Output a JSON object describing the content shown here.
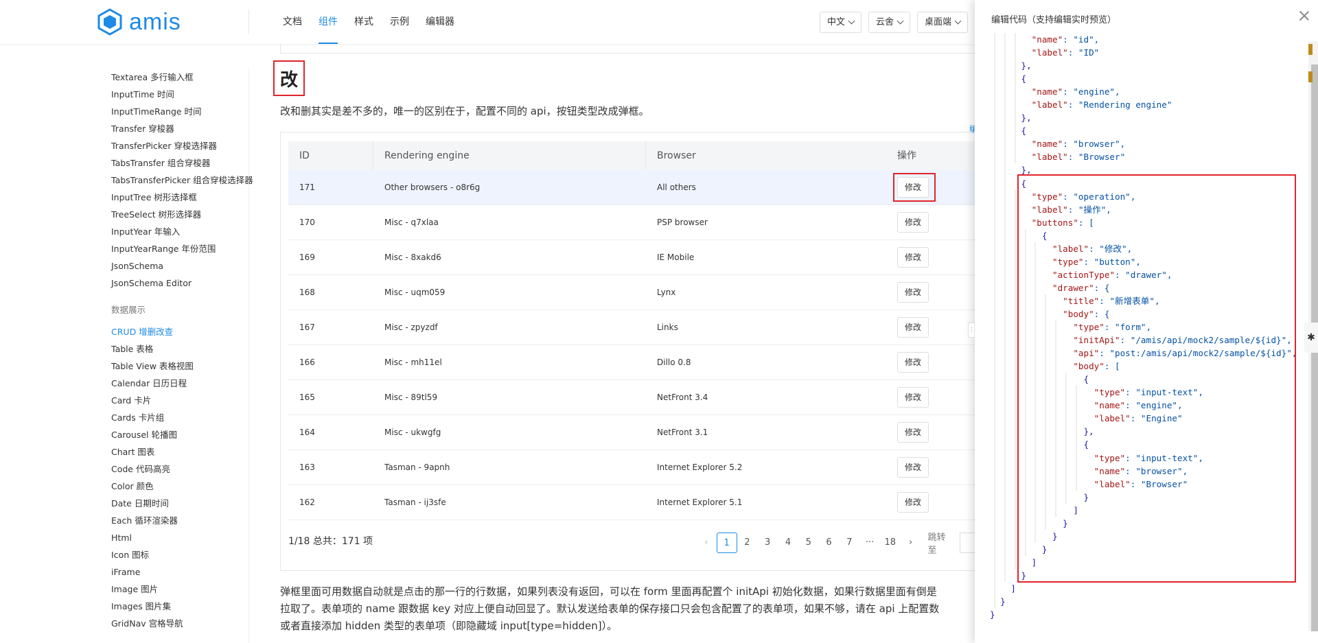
{
  "header": {
    "logo_text": "amis",
    "nav": [
      "文档",
      "组件",
      "样式",
      "示例",
      "编辑器"
    ],
    "nav_active": 1,
    "selects": [
      "中文",
      "云舍",
      "桌面端"
    ]
  },
  "sidebar": {
    "items_top": [
      "Textarea 多行输入框",
      "InputTime 时间",
      "InputTimeRange 时间",
      "Transfer 穿梭器",
      "TransferPicker 穿梭选择器",
      "TabsTransfer 组合穿梭器",
      "TabsTransferPicker 组合穿梭选择器",
      "InputTree 树形选择框",
      "TreeSelect 树形选择器",
      "InputYear 年输入",
      "InputYearRange 年份范围",
      "JsonSchema",
      "JsonSchema Editor"
    ],
    "group_label": "数据展示",
    "items_bottom": [
      "CRUD 增删改查",
      "Table 表格",
      "Table View 表格视图",
      "Calendar 日历日程",
      "Card 卡片",
      "Cards 卡片组",
      "Carousel 轮播图",
      "Chart 图表",
      "Code 代码高亮",
      "Color 颜色",
      "Date 日期时间",
      "Each 循环渲染器",
      "Html",
      "Icon 图标",
      "iFrame",
      "Image 图片",
      "Images 图片集",
      "GridNav 宫格导航"
    ],
    "active_item": "CRUD 增删改查"
  },
  "content": {
    "heading": "改",
    "intro": "改和删其实是差不多的，唯一的区别在于，配置不同的 api，按钮类型改成弹框。",
    "edit_link": "编",
    "table": {
      "headers": [
        "ID",
        "Rendering engine",
        "Browser",
        "操作"
      ],
      "rows": [
        [
          "171",
          "Other browsers - o8r6g",
          "All others",
          "修改"
        ],
        [
          "170",
          "Misc - q7xlaa",
          "PSP browser",
          "修改"
        ],
        [
          "169",
          "Misc - 8xakd6",
          "IE Mobile",
          "修改"
        ],
        [
          "168",
          "Misc - uqm059",
          "Lynx",
          "修改"
        ],
        [
          "167",
          "Misc - zpyzdf",
          "Links",
          "修改"
        ],
        [
          "166",
          "Misc - mh11el",
          "Dillo 0.8",
          "修改"
        ],
        [
          "165",
          "Misc - 89tl59",
          "NetFront 3.4",
          "修改"
        ],
        [
          "164",
          "Misc - ukwgfg",
          "NetFront 3.1",
          "修改"
        ],
        [
          "163",
          "Tasman - 9apnh",
          "Internet Explorer 5.2",
          "修改"
        ],
        [
          "162",
          "Tasman - ij3sfe",
          "Internet Explorer 5.1",
          "修改"
        ]
      ]
    },
    "total": "1/18 总共：171 项",
    "pager": [
      "1",
      "2",
      "3",
      "4",
      "5",
      "6",
      "7",
      "···",
      "18"
    ],
    "pager_active": "1",
    "jump_label": "跳转至",
    "paragraph": [
      "弹框里面可用数据自动就是点击的那一行的行数据，如果列表没有返回，可以在 form 里面再配置个 initApi 初始化数据，如果行数据里面有倒是",
      "拉取了。表单项的 name 跟数据 key 对应上便自动回显了。默认发送给表单的保存接口只会包含配置了的表单项，如果不够，请在 api 上配置数",
      "或者直接添加 hidden 类型的表单项（即隐藏域 input[type=hidden]）。"
    ]
  },
  "drawer": {
    "title": "编辑代码（支持编辑实时预览）",
    "code_lines": [
      "        \"name\": \"id\",",
      "        \"label\": \"ID\"",
      "      },",
      "      {",
      "        \"name\": \"engine\",",
      "        \"label\": \"Rendering engine\"",
      "      },",
      "      {",
      "        \"name\": \"browser\",",
      "        \"label\": \"Browser\"",
      "      },",
      "      {",
      "        \"type\": \"operation\",",
      "        \"label\": \"操作\",",
      "        \"buttons\": [",
      "          {",
      "            \"label\": \"修改\",",
      "            \"type\": \"button\",",
      "            \"actionType\": \"drawer\",",
      "            \"drawer\": {",
      "              \"title\": \"新增表单\",",
      "              \"body\": {",
      "                \"type\": \"form\",",
      "                \"initApi\": \"/amis/api/mock2/sample/${id}\",",
      "                \"api\": \"post:/amis/api/mock2/sample/${id}\",",
      "                \"body\": [",
      "                  {",
      "                    \"type\": \"input-text\",",
      "                    \"name\": \"engine\",",
      "                    \"label\": \"Engine\"",
      "                  },",
      "                  {",
      "                    \"type\": \"input-text\",",
      "                    \"name\": \"browser\",",
      "                    \"label\": \"Browser\"",
      "                  }",
      "                ]",
      "              }",
      "            }",
      "          }",
      "        ]",
      "      }",
      "    ]",
      "  }",
      "}"
    ]
  }
}
